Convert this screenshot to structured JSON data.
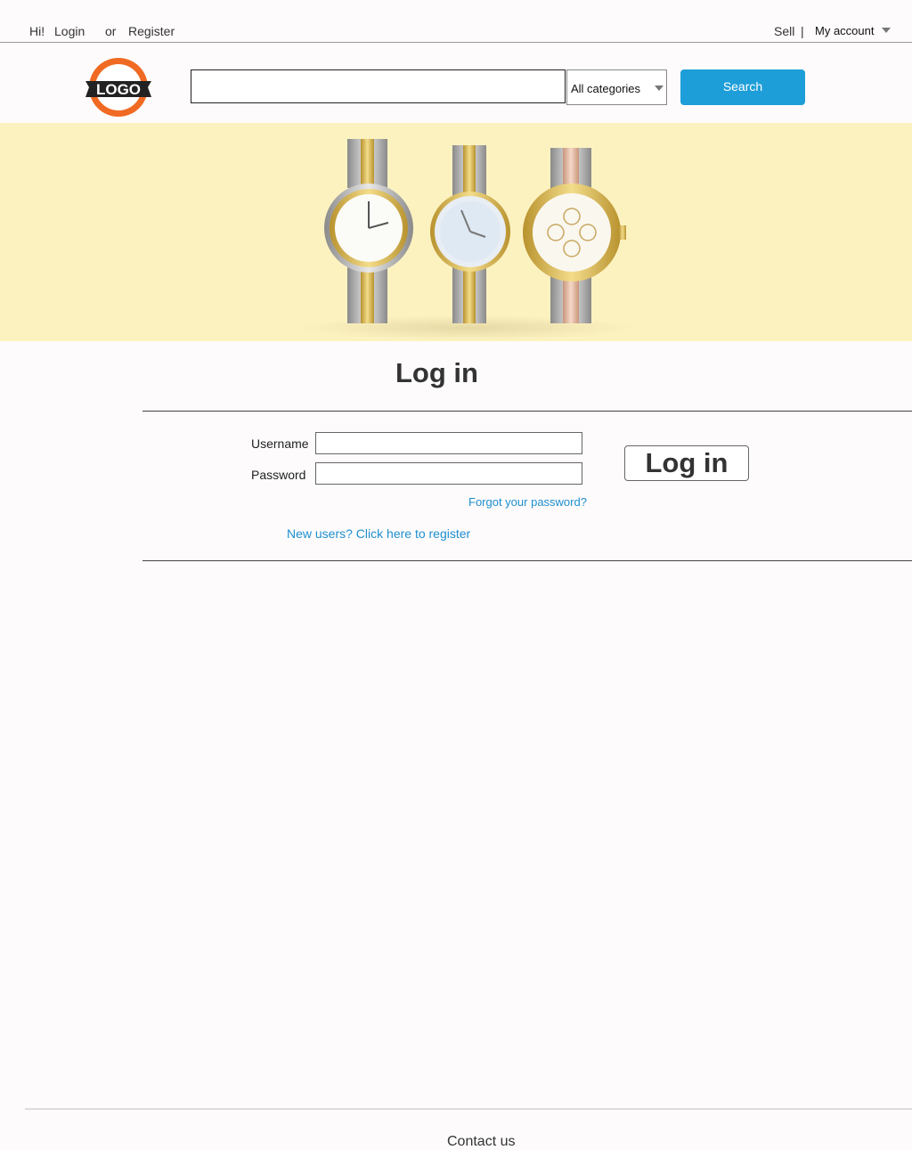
{
  "topbar": {
    "greeting": "Hi!",
    "login_label": "Login",
    "or_label": "or",
    "register_label": "Register",
    "sell_label": "Sell",
    "separator": "|",
    "account_label": "My account"
  },
  "header": {
    "logo_text": "LOGO",
    "search_placeholder": "",
    "category_selected": "All categories",
    "search_button": "Search"
  },
  "login": {
    "title": "Log in",
    "username_label": "Username",
    "password_label": "Password",
    "forgot_link": "Forgot your password?",
    "register_link": "New users? Click here to register",
    "submit_label": "Log in"
  },
  "footer": {
    "contact_label": "Contact us"
  },
  "colors": {
    "accent": "#1e9ed8",
    "banner_bg": "#fcf2c0",
    "logo_orange": "#f06a23"
  }
}
